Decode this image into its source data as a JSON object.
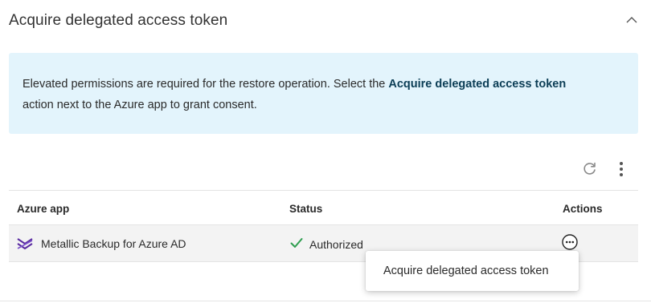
{
  "section": {
    "title": "Acquire delegated access token"
  },
  "banner": {
    "text_before": "Elevated permissions are required for the restore operation. Select the ",
    "bold_text": "Acquire delegated access token",
    "text_after": "action next to the Azure app to grant consent."
  },
  "toolbar": {
    "refresh_icon": "refresh-icon",
    "more_icon": "more-vertical-icon"
  },
  "table": {
    "columns": [
      "Azure app",
      "Status",
      "Actions"
    ],
    "rows": [
      {
        "app": "Metallic Backup for Azure AD",
        "app_icon": "azure-app-icon",
        "status": "Authorized",
        "status_icon": "check-icon",
        "status_color": "#2e9e4f"
      }
    ]
  },
  "context_menu": {
    "items": [
      "Acquire delegated access token"
    ]
  },
  "colors": {
    "banner_bg": "#e3f4fc",
    "banner_bold": "#0b3d55",
    "row_bg": "#f3f3f3",
    "app_icon_purple": "#5a2ca0"
  }
}
